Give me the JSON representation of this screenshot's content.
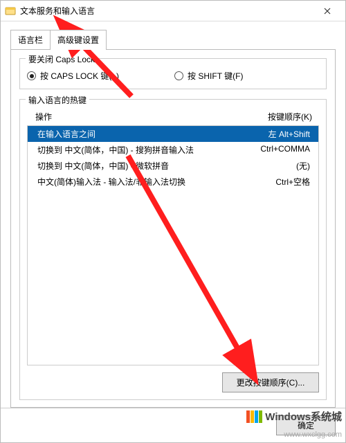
{
  "window": {
    "title": "文本服务和输入语言"
  },
  "tabs": {
    "language_bar": "语言栏",
    "advanced_key": "高级键设置"
  },
  "capslock": {
    "legend": "要关闭 Caps Lock",
    "opt_capslock": "按 CAPS LOCK 键(L)",
    "opt_shift": "按 SHIFT 键(F)"
  },
  "hotkeys": {
    "legend": "输入语言的热键",
    "col_action": "操作",
    "col_keys": "按键顺序(K)",
    "rows": [
      {
        "action": "在输入语言之间",
        "keys": "左 Alt+Shift",
        "selected": true
      },
      {
        "action": "切换到 中文(简体，中国) - 搜狗拼音输入法",
        "keys": "Ctrl+COMMA",
        "selected": false
      },
      {
        "action": "切换到 中文(简体，中国) - 微软拼音",
        "keys": "(无)",
        "selected": false
      },
      {
        "action": "中文(简体)输入法 - 输入法/非输入法切换",
        "keys": "Ctrl+空格",
        "selected": false
      }
    ],
    "change_btn": "更改按键顺序(C)..."
  },
  "footer": {
    "ok": "确定"
  },
  "branding": {
    "logo_text": "Windows系统城",
    "watermark": "www.wxclgg.com"
  }
}
